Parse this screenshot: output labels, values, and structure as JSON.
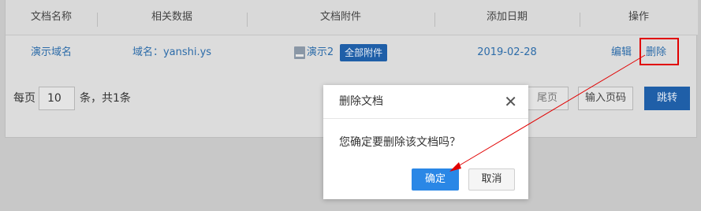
{
  "table": {
    "headers": [
      "文档名称",
      "相关数据",
      "文档附件",
      "添加日期",
      "操作"
    ],
    "row": {
      "name": "演示域名",
      "related": "域名：yanshi.ys",
      "attachment": "演示2",
      "attachment_badge": "全部附件",
      "date": "2019-02-28",
      "edit": "编辑",
      "delete": "删除"
    }
  },
  "pager": {
    "per_page_prefix": "每页",
    "per_page_value": "10",
    "per_page_suffix": "条，共1条",
    "last_page": "尾页",
    "input_page": "输入页码",
    "go": "跳转"
  },
  "modal": {
    "title": "删除文档",
    "message": "您确定要删除该文档吗？",
    "confirm": "确定",
    "cancel": "取消",
    "close_icon": "close-icon"
  },
  "colors": {
    "link": "#2d6ca9",
    "primary_dark": "#1f5fa8",
    "primary_button": "#2a87e6",
    "annotation_red": "#e10000"
  }
}
